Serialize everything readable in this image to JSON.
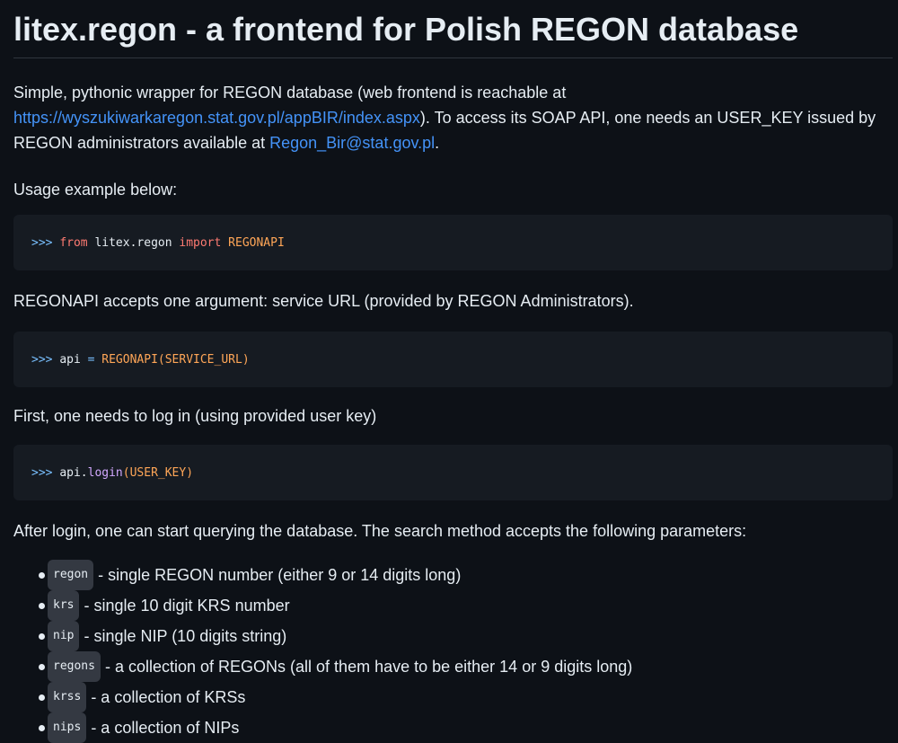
{
  "title": "litex.regon - a frontend for Polish REGON database",
  "intro": {
    "text1": "Simple, pythonic wrapper for REGON database (web frontend is reachable at ",
    "link1": "https://wyszukiwarkaregon.stat.gov.pl/appBIR/index.aspx",
    "text2": "). To access its SOAP API, one needs an USER_KEY issued by REGON administrators available at ",
    "link2": "Regon_Bir@stat.gov.pl",
    "text3": "."
  },
  "usage_label": "Usage example below:",
  "code1": {
    "prompt": ">>>",
    "kw1": "from",
    "mod": "litex.regon",
    "kw2": "import",
    "cls": "REGONAPI"
  },
  "regonapi_desc": "REGONAPI accepts one argument: service URL (provided by REGON Administrators).",
  "code2": {
    "prompt": ">>>",
    "var": "api",
    "op": "=",
    "call": "REGONAPI(SERVICE_URL)"
  },
  "login_desc": "First, one needs to log in (using provided user key)",
  "code3": {
    "prompt": ">>>",
    "obj": "api.",
    "method": "login",
    "args": "(USER_KEY)"
  },
  "search_desc": "After login, one can start querying the database. The search method accepts the following parameters:",
  "params": [
    {
      "name": "regon",
      "desc": "- single REGON number (either 9 or 14 digits long)"
    },
    {
      "name": "krs",
      "desc": "- single 10 digit KRS number"
    },
    {
      "name": "nip",
      "desc": "- single NIP (10 digits string)"
    },
    {
      "name": "regons",
      "desc": "- a collection of REGONs (all of them have to be either 14 or 9 digits long)"
    },
    {
      "name": "krss",
      "desc": "- a collection of KRSs"
    },
    {
      "name": "nips",
      "desc": "- a collection of NIPs"
    }
  ]
}
